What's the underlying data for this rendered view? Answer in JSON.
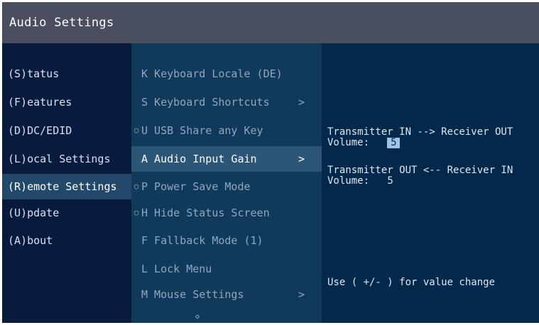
{
  "window": {
    "title": "Audio Settings"
  },
  "main_menu": [
    {
      "label": "(S)tatus",
      "selected": false
    },
    {
      "label": "(F)eatures",
      "selected": false
    },
    {
      "label": "(D)DC/EDID",
      "selected": false
    },
    {
      "label": "(L)ocal  Settings",
      "selected": false
    },
    {
      "label": "(R)emote Settings",
      "selected": true
    },
    {
      "label": "(U)pdate",
      "selected": false
    },
    {
      "label": "(A)bout",
      "selected": false
    }
  ],
  "submenu": [
    {
      "bullet": "",
      "label": "K Keyboard Locale (DE)",
      "arrow": "",
      "selected": false
    },
    {
      "bullet": "",
      "label": "S Keyboard Shortcuts",
      "arrow": ">",
      "selected": false
    },
    {
      "bullet": "○",
      "label": "U USB Share any Key",
      "arrow": "",
      "selected": false
    },
    {
      "bullet": "",
      "label": "A Audio Input Gain",
      "arrow": ">",
      "selected": true
    },
    {
      "bullet": "○",
      "label": "P Power Save Mode",
      "arrow": "",
      "selected": false
    },
    {
      "bullet": "○",
      "label": "H Hide Status Screen",
      "arrow": "",
      "selected": false
    },
    {
      "bullet": "",
      "label": "F Fallback Mode (1)",
      "arrow": "",
      "selected": false
    },
    {
      "bullet": "",
      "label": "L Lock Menu",
      "arrow": "",
      "selected": false
    },
    {
      "bullet": "",
      "label": "M Mouse Settings",
      "arrow": ">",
      "selected": false
    }
  ],
  "more_indicator": "◇",
  "audio": {
    "transmitter_in": {
      "heading": "Transmitter IN --> Receiver OUT",
      "volume_label": "Volume:",
      "volume_value": "5"
    },
    "transmitter_out": {
      "heading": "Transmitter OUT <-- Receiver IN",
      "volume_label": "Volume:",
      "volume_value": "5"
    },
    "hint": "Use ( +/- ) for value change"
  },
  "colors": {
    "title_bar": "#4a4f5f",
    "left_panel": "#081a3e",
    "mid_panel": "#103a5b",
    "right_panel": "#02284c",
    "selection": "#2b5677"
  }
}
